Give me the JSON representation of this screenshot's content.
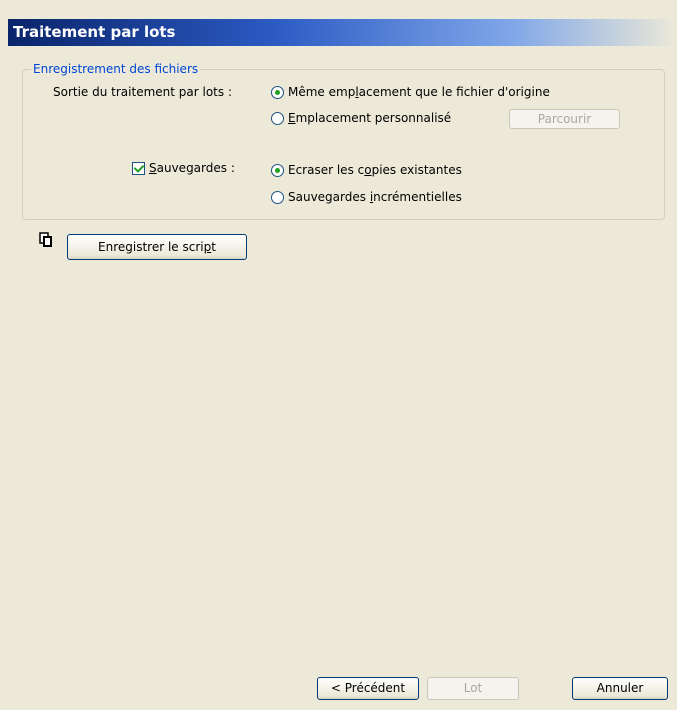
{
  "window": {
    "title": "Traitement par lots"
  },
  "group": {
    "legend": "Enregistrement des fichiers",
    "output": {
      "label": "Sortie du traitement par lots :",
      "option_same": {
        "text": "Même emp",
        "underline": "l",
        "text_after": "acement que le fichier d'origine",
        "selected": true
      },
      "option_custom": {
        "text": "",
        "underline": "E",
        "text_after": "mplacement personnalisé",
        "selected": false
      },
      "browse_button": "Parcourir"
    },
    "backups": {
      "checkbox_underline": "S",
      "checkbox_label": "auvegardes :",
      "checked": true,
      "option_overwrite": {
        "text": "Ecraser les c",
        "underline": "o",
        "text_after": "pies existantes",
        "selected": true
      },
      "option_incremental": {
        "text": "Sauvegardes ",
        "underline": "i",
        "text_after": "ncrémentielles",
        "selected": false
      }
    }
  },
  "script_button": {
    "text": "Enregistrer le scri",
    "underline": "p",
    "text_after": "t"
  },
  "icons": {
    "copy": "copy-icon"
  },
  "footer": {
    "back": "< Précédent",
    "batch": "Lot",
    "cancel": "Annuler"
  }
}
